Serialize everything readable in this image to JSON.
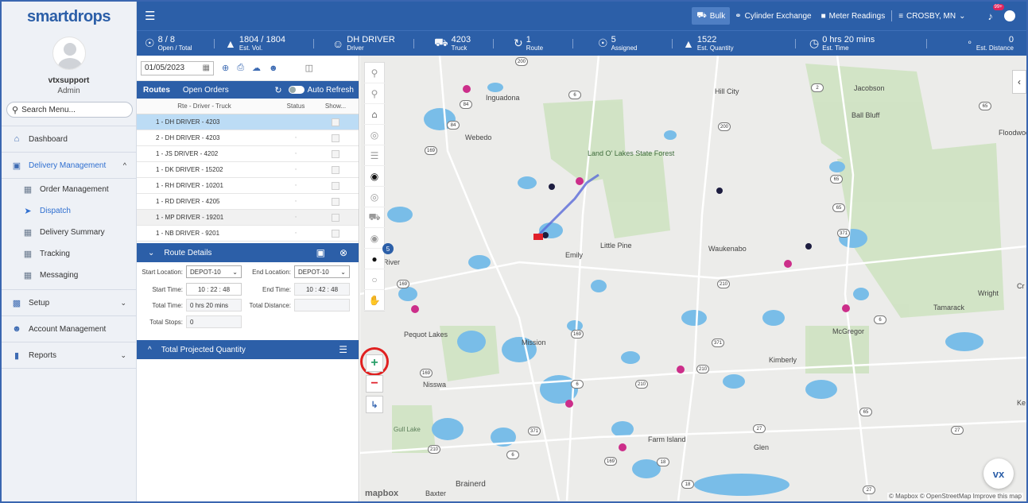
{
  "brand": {
    "logo": "smartdrops"
  },
  "user": {
    "name": "vtxsupport",
    "role": "Admin"
  },
  "search": {
    "placeholder": "Search Menu..."
  },
  "menu": {
    "dashboard": "Dashboard",
    "delivery_management": "Delivery Management",
    "sub": [
      "Order Management",
      "Dispatch",
      "Delivery Summary",
      "Tracking",
      "Messaging"
    ],
    "setup": "Setup",
    "account_management": "Account Management",
    "reports": "Reports"
  },
  "topbar": {
    "bulk": "Bulk",
    "cylinder": "Cylinder Exchange",
    "meter": "Meter Readings",
    "location": "CROSBY, MN",
    "notif_badge": "99+"
  },
  "stats": [
    {
      "value": "8 / 8",
      "label": "Open / Total",
      "icon": "list-icon"
    },
    {
      "value": "1804 / 1804",
      "label": "Est. Vol.",
      "icon": "tank-icon"
    },
    {
      "value": "DH DRIVER",
      "label": "Driver",
      "icon": "driver-icon"
    },
    {
      "value": "4203",
      "label": "Truck",
      "icon": "truck-icon"
    },
    {
      "value": "1",
      "label": "Route",
      "icon": "route-icon"
    },
    {
      "value": "5",
      "label": "Assigned",
      "icon": "assigned-icon"
    },
    {
      "value": "1522",
      "label": "Est. Quantity",
      "icon": "tank-icon"
    },
    {
      "value": "0 hrs 20 mins",
      "label": "Est. Time",
      "icon": "clock-icon"
    },
    {
      "value": "0",
      "label": "Est. Distance",
      "icon": "distance-icon"
    }
  ],
  "panel": {
    "date": "01/05/2023",
    "tabs": {
      "routes": "Routes",
      "open_orders": "Open Orders",
      "auto_refresh": "Auto Refresh"
    },
    "columns": {
      "route": "Rte - Driver - Truck",
      "status": "Status",
      "show": "Show..."
    },
    "routes": [
      "1 - DH DRIVER - 4203",
      "2 - DH DRIVER - 4203",
      "1 - JS DRIVER - 4202",
      "1 - DK DRIVER - 15202",
      "1 - RH DRIVER - 10201",
      "1 - RD DRIVER - 4205",
      "1 - MP DRIVER - 19201",
      "1 - NB DRIVER - 9201"
    ],
    "route_details": {
      "title": "Route Details",
      "start_location_label": "Start Location:",
      "start_location": "DEPOT-10",
      "end_location_label": "End Location:",
      "end_location": "DEPOT-10",
      "start_time_label": "Start Time:",
      "start_time": "10 : 22 : 48",
      "end_time_label": "End Time:",
      "end_time": "10 : 42 : 48",
      "total_time_label": "Total Time:",
      "total_time": "0 hrs 20 mins",
      "total_distance_label": "Total Distance:",
      "total_distance": "",
      "total_stops_label": "Total Stops:",
      "total_stops": "0"
    },
    "tpq_title": "Total Projected Quantity"
  },
  "map": {
    "badge": "5",
    "places": [
      "Inguadona",
      "Webedo",
      "Land O' Lakes State Forest",
      "Little Pine",
      "Emily",
      "Waukenabo",
      "Hill City",
      "Jacobson",
      "Ball Bluff",
      "Floodwood",
      "Wright",
      "Tamarack",
      "McGregor",
      "Kimberly",
      "Pequot Lakes",
      "Mission",
      "Nisswa",
      "Gull Lake",
      "Farm Island",
      "Glen",
      "Brainerd",
      "Baxter",
      "River",
      "Cr",
      "Ke"
    ],
    "route_shields": [
      "200",
      "6",
      "84",
      "84",
      "169",
      "200",
      "2",
      "65",
      "65",
      "65",
      "371",
      "169",
      "210",
      "6",
      "169",
      "371",
      "169",
      "210",
      "210",
      "371",
      "210",
      "6",
      "169",
      "18",
      "65",
      "27",
      "27",
      "18",
      "27",
      "6"
    ],
    "attribution": "© Mapbox © OpenStreetMap Improve this map",
    "mapbox": "mapbox",
    "vx": "vx"
  }
}
